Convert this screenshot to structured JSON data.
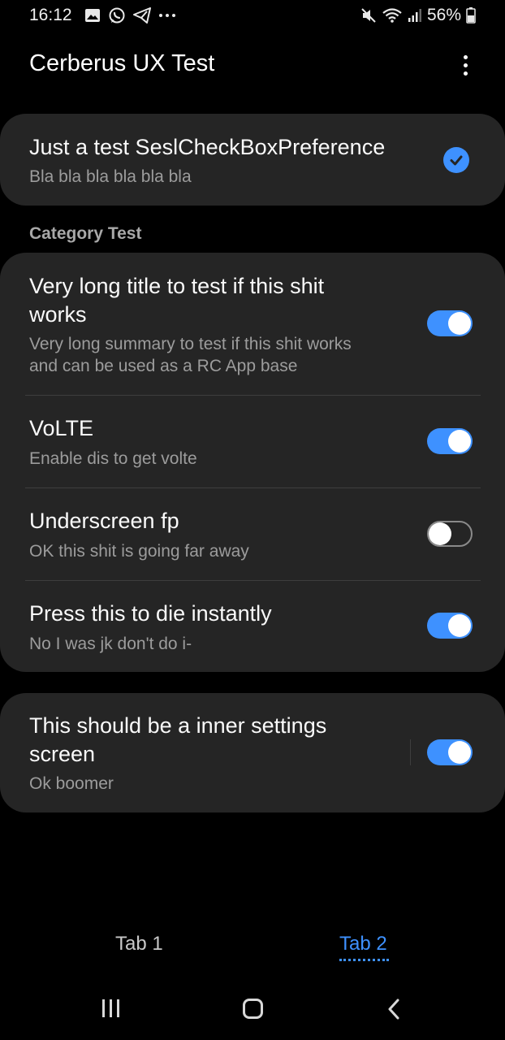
{
  "status_bar": {
    "time": "16:12",
    "battery": "56%",
    "left_icons": [
      "gallery-icon",
      "whatsapp-icon",
      "telegram-icon",
      "more-notifications-icon"
    ],
    "right_icons": [
      "mute-icon",
      "wifi-icon",
      "signal-icon",
      "battery-icon"
    ]
  },
  "app_bar": {
    "title": "Cerberus UX Test",
    "menu_icon": "more-vertical-icon"
  },
  "card1": {
    "title": "Just a test SeslCheckBoxPreference",
    "summary": "Bla bla bla bla bla bla",
    "checked": true
  },
  "category": {
    "label": "Category Test",
    "items": [
      {
        "title_line1": "Very long title to test if this shit",
        "title_line2": "works",
        "summary_line1": "Very long summary to test if this shit works",
        "summary_line2": "and can be used as a RC App base",
        "enabled": true
      },
      {
        "title": "VoLTE",
        "summary": "Enable dis to get volte",
        "enabled": true
      },
      {
        "title": "Underscreen fp",
        "summary": "OK this shit is going far away",
        "enabled": false
      },
      {
        "title": "Press this to die instantly",
        "summary": "No I was jk don't do i-",
        "enabled": true
      }
    ]
  },
  "card3": {
    "title_line1": "This should be a inner settings",
    "title_line2": "screen",
    "summary": "Ok boomer",
    "enabled": true
  },
  "tabs": {
    "tab1": "Tab 1",
    "tab2": "Tab 2",
    "selected": "Tab 2"
  },
  "colors": {
    "accent": "#3e91ff",
    "card_bg": "#252525",
    "background": "#000000",
    "summary_text": "#9c9c9c"
  }
}
